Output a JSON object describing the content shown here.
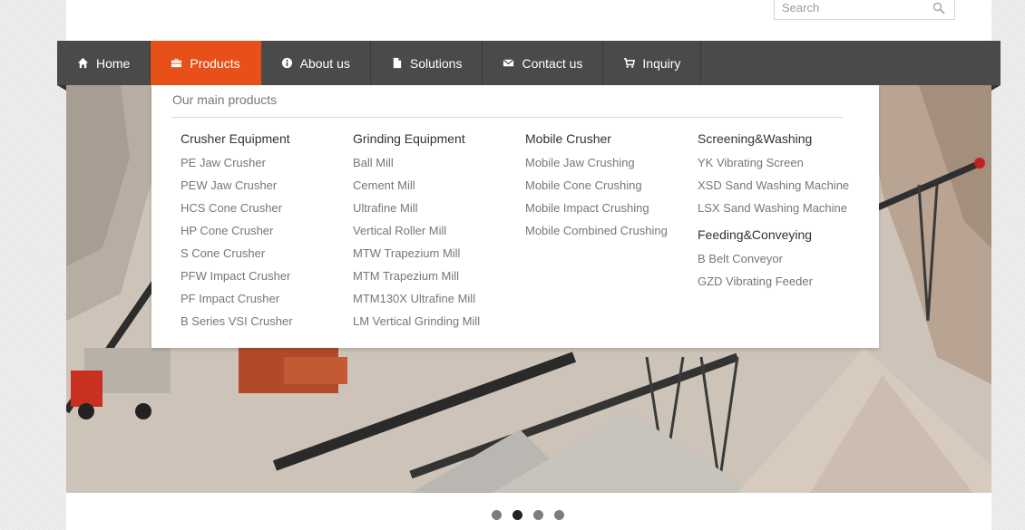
{
  "search": {
    "placeholder": "Search",
    "icon": "search-icon"
  },
  "nav": {
    "items": [
      {
        "label": "Home",
        "icon": "home-icon",
        "active": false
      },
      {
        "label": "Products",
        "icon": "briefcase-icon",
        "active": true
      },
      {
        "label": "About us",
        "icon": "info-icon",
        "active": false
      },
      {
        "label": "Solutions",
        "icon": "document-icon",
        "active": false
      },
      {
        "label": "Contact us",
        "icon": "envelope-icon",
        "active": false
      },
      {
        "label": "Inquiry",
        "icon": "cart-icon",
        "active": false
      }
    ],
    "active_color": "#e8501a",
    "bar_color": "#4a4a4a"
  },
  "dropdown": {
    "title": "Our main products",
    "columns": [
      {
        "heading": "Crusher Equipment",
        "links": [
          "PE Jaw Crusher",
          "PEW Jaw Crusher",
          "HCS Cone Crusher",
          "HP Cone Crusher",
          "S Cone Crusher",
          "PFW Impact Crusher",
          "PF Impact Crusher",
          "B Series VSI Crusher"
        ]
      },
      {
        "heading": "Grinding Equipment",
        "links": [
          "Ball Mill",
          "Cement Mill",
          "Ultrafine Mill",
          "Vertical Roller Mill",
          "MTW Trapezium Mill",
          "MTM Trapezium Mill",
          "MTM130X Ultrafine Mill",
          "LM Vertical Grinding Mill"
        ]
      },
      {
        "heading": "Mobile Crusher",
        "links": [
          "Mobile Jaw Crushing",
          "Mobile Cone Crushing",
          "Mobile Impact Crushing",
          "Mobile Combined Crushing"
        ]
      },
      {
        "heading": "Screening&Washing",
        "links": [
          "YK Vibrating Screen",
          "XSD Sand Washing Machine",
          "LSX Sand Washing Machine"
        ],
        "sub_heading": "Feeding&Conveying",
        "sub_links": [
          "B Belt Conveyor",
          "GZD Vibrating Feeder"
        ]
      }
    ]
  },
  "slider": {
    "slide_count": 4,
    "active_index": 1
  }
}
